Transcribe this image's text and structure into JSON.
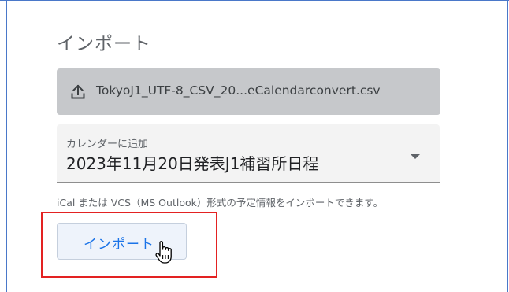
{
  "dialog": {
    "title": "インポート"
  },
  "file_picker": {
    "icon": "upload-icon",
    "file_name": "TokyoJ1_UTF-8_CSV_20...eCalendarconvert.csv"
  },
  "calendar_select": {
    "label": "カレンダーに追加",
    "selected_value": "2023年11月20日発表J1補習所日程",
    "icon": "dropdown-caret-icon"
  },
  "helper_text": "iCal または VCS（MS Outlook）形式の予定情報をインポートできます。",
  "import_button": {
    "label": "インポート"
  },
  "colors": {
    "accent": "#1a73e8",
    "highlight": "#e32222",
    "file_button_bg": "#c6c8cb"
  }
}
